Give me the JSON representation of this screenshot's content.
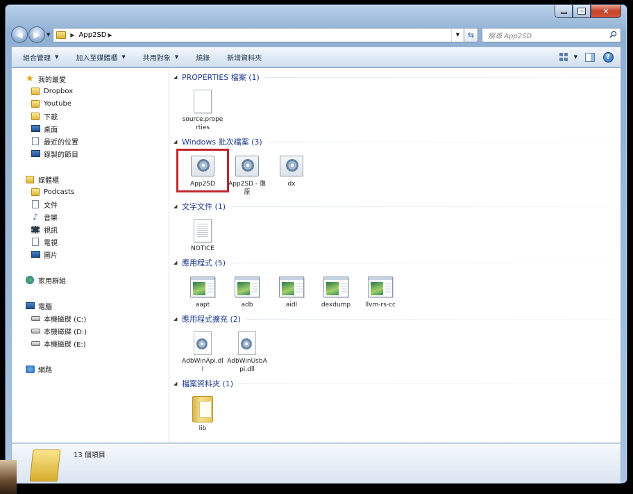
{
  "window": {
    "caption_buttons": {
      "minimize": "minimize",
      "maximize": "maximize",
      "close": "✕"
    }
  },
  "navbar": {
    "back_icon": "◀",
    "forward_icon": "▶",
    "breadcrumb": [
      "App2SD"
    ],
    "search_placeholder": "搜尋 App2SD"
  },
  "toolbar": {
    "items": [
      {
        "label": "組合管理",
        "has_dropdown": true
      },
      {
        "label": "加入至媒體櫃",
        "has_dropdown": true
      },
      {
        "label": "共用對象",
        "has_dropdown": true
      },
      {
        "label": "燒錄",
        "has_dropdown": false
      },
      {
        "label": "新增資料夾",
        "has_dropdown": false
      }
    ],
    "help": "?"
  },
  "sidebar": {
    "favorites": {
      "label": "我的最愛",
      "items": [
        "Dropbox",
        "Youtube",
        "下載",
        "桌面",
        "最近的位置",
        "錄製的節目"
      ]
    },
    "libraries": {
      "label": "媒體櫃",
      "items": [
        "Podcasts",
        "文件",
        "音樂",
        "視訊",
        "電視",
        "圖片"
      ]
    },
    "homegroup": {
      "label": "家用群組"
    },
    "computer": {
      "label": "電腦",
      "items": [
        "本機磁碟 (C:)",
        "本機磁碟 (D:)",
        "本機磁碟 (E:)"
      ]
    },
    "network": {
      "label": "網路"
    }
  },
  "groups": [
    {
      "title": "PROPERTIES 檔案 (1)",
      "items": [
        {
          "name": "source.properties",
          "icon": "page-icon"
        }
      ]
    },
    {
      "title": "Windows 批次檔案 (3)",
      "items": [
        {
          "name": "App2SD",
          "icon": "batch-gear-icon",
          "selected": true
        },
        {
          "name": "App2SD - 復原",
          "icon": "batch-gear-icon"
        },
        {
          "name": "dx",
          "icon": "batch-gear-icon"
        }
      ]
    },
    {
      "title": "文字文件 (1)",
      "items": [
        {
          "name": "NOTICE",
          "icon": "text-document-icon"
        }
      ]
    },
    {
      "title": "應用程式 (5)",
      "items": [
        {
          "name": "aapt",
          "icon": "application-icon"
        },
        {
          "name": "adb",
          "icon": "application-icon"
        },
        {
          "name": "aidl",
          "icon": "application-icon"
        },
        {
          "name": "dexdump",
          "icon": "application-icon"
        },
        {
          "name": "llvm-rs-cc",
          "icon": "application-icon"
        }
      ]
    },
    {
      "title": "應用程式擴充 (2)",
      "items": [
        {
          "name": "AdbWinApi.dll",
          "icon": "dll-icon"
        },
        {
          "name": "AdbWinUsbApi.dll",
          "icon": "dll-icon"
        }
      ]
    },
    {
      "title": "檔案資料夾 (1)",
      "items": [
        {
          "name": "lib",
          "icon": "folder-icon"
        }
      ]
    }
  ],
  "status": {
    "item_count": "13 個項目"
  },
  "colors": {
    "selection_outline": "#c0262d",
    "group_header": "#1e3a8c"
  }
}
